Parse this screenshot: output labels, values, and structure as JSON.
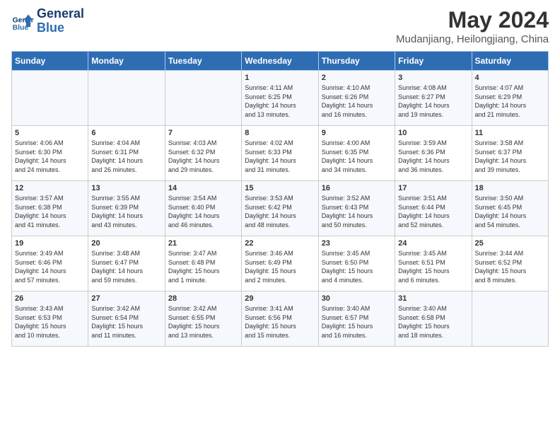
{
  "header": {
    "logo_line1": "General",
    "logo_line2": "Blue",
    "main_title": "May 2024",
    "subtitle": "Mudanjiang, Heilongjiang, China"
  },
  "days_of_week": [
    "Sunday",
    "Monday",
    "Tuesday",
    "Wednesday",
    "Thursday",
    "Friday",
    "Saturday"
  ],
  "weeks": [
    [
      {
        "day": "",
        "text": ""
      },
      {
        "day": "",
        "text": ""
      },
      {
        "day": "",
        "text": ""
      },
      {
        "day": "1",
        "text": "Sunrise: 4:11 AM\nSunset: 6:25 PM\nDaylight: 14 hours\nand 13 minutes."
      },
      {
        "day": "2",
        "text": "Sunrise: 4:10 AM\nSunset: 6:26 PM\nDaylight: 14 hours\nand 16 minutes."
      },
      {
        "day": "3",
        "text": "Sunrise: 4:08 AM\nSunset: 6:27 PM\nDaylight: 14 hours\nand 19 minutes."
      },
      {
        "day": "4",
        "text": "Sunrise: 4:07 AM\nSunset: 6:29 PM\nDaylight: 14 hours\nand 21 minutes."
      }
    ],
    [
      {
        "day": "5",
        "text": "Sunrise: 4:06 AM\nSunset: 6:30 PM\nDaylight: 14 hours\nand 24 minutes."
      },
      {
        "day": "6",
        "text": "Sunrise: 4:04 AM\nSunset: 6:31 PM\nDaylight: 14 hours\nand 26 minutes."
      },
      {
        "day": "7",
        "text": "Sunrise: 4:03 AM\nSunset: 6:32 PM\nDaylight: 14 hours\nand 29 minutes."
      },
      {
        "day": "8",
        "text": "Sunrise: 4:02 AM\nSunset: 6:33 PM\nDaylight: 14 hours\nand 31 minutes."
      },
      {
        "day": "9",
        "text": "Sunrise: 4:00 AM\nSunset: 6:35 PM\nDaylight: 14 hours\nand 34 minutes."
      },
      {
        "day": "10",
        "text": "Sunrise: 3:59 AM\nSunset: 6:36 PM\nDaylight: 14 hours\nand 36 minutes."
      },
      {
        "day": "11",
        "text": "Sunrise: 3:58 AM\nSunset: 6:37 PM\nDaylight: 14 hours\nand 39 minutes."
      }
    ],
    [
      {
        "day": "12",
        "text": "Sunrise: 3:57 AM\nSunset: 6:38 PM\nDaylight: 14 hours\nand 41 minutes."
      },
      {
        "day": "13",
        "text": "Sunrise: 3:55 AM\nSunset: 6:39 PM\nDaylight: 14 hours\nand 43 minutes."
      },
      {
        "day": "14",
        "text": "Sunrise: 3:54 AM\nSunset: 6:40 PM\nDaylight: 14 hours\nand 46 minutes."
      },
      {
        "day": "15",
        "text": "Sunrise: 3:53 AM\nSunset: 6:42 PM\nDaylight: 14 hours\nand 48 minutes."
      },
      {
        "day": "16",
        "text": "Sunrise: 3:52 AM\nSunset: 6:43 PM\nDaylight: 14 hours\nand 50 minutes."
      },
      {
        "day": "17",
        "text": "Sunrise: 3:51 AM\nSunset: 6:44 PM\nDaylight: 14 hours\nand 52 minutes."
      },
      {
        "day": "18",
        "text": "Sunrise: 3:50 AM\nSunset: 6:45 PM\nDaylight: 14 hours\nand 54 minutes."
      }
    ],
    [
      {
        "day": "19",
        "text": "Sunrise: 3:49 AM\nSunset: 6:46 PM\nDaylight: 14 hours\nand 57 minutes."
      },
      {
        "day": "20",
        "text": "Sunrise: 3:48 AM\nSunset: 6:47 PM\nDaylight: 14 hours\nand 59 minutes."
      },
      {
        "day": "21",
        "text": "Sunrise: 3:47 AM\nSunset: 6:48 PM\nDaylight: 15 hours\nand 1 minute."
      },
      {
        "day": "22",
        "text": "Sunrise: 3:46 AM\nSunset: 6:49 PM\nDaylight: 15 hours\nand 2 minutes."
      },
      {
        "day": "23",
        "text": "Sunrise: 3:45 AM\nSunset: 6:50 PM\nDaylight: 15 hours\nand 4 minutes."
      },
      {
        "day": "24",
        "text": "Sunrise: 3:45 AM\nSunset: 6:51 PM\nDaylight: 15 hours\nand 6 minutes."
      },
      {
        "day": "25",
        "text": "Sunrise: 3:44 AM\nSunset: 6:52 PM\nDaylight: 15 hours\nand 8 minutes."
      }
    ],
    [
      {
        "day": "26",
        "text": "Sunrise: 3:43 AM\nSunset: 6:53 PM\nDaylight: 15 hours\nand 10 minutes."
      },
      {
        "day": "27",
        "text": "Sunrise: 3:42 AM\nSunset: 6:54 PM\nDaylight: 15 hours\nand 11 minutes."
      },
      {
        "day": "28",
        "text": "Sunrise: 3:42 AM\nSunset: 6:55 PM\nDaylight: 15 hours\nand 13 minutes."
      },
      {
        "day": "29",
        "text": "Sunrise: 3:41 AM\nSunset: 6:56 PM\nDaylight: 15 hours\nand 15 minutes."
      },
      {
        "day": "30",
        "text": "Sunrise: 3:40 AM\nSunset: 6:57 PM\nDaylight: 15 hours\nand 16 minutes."
      },
      {
        "day": "31",
        "text": "Sunrise: 3:40 AM\nSunset: 6:58 PM\nDaylight: 15 hours\nand 18 minutes."
      },
      {
        "day": "",
        "text": ""
      }
    ]
  ]
}
